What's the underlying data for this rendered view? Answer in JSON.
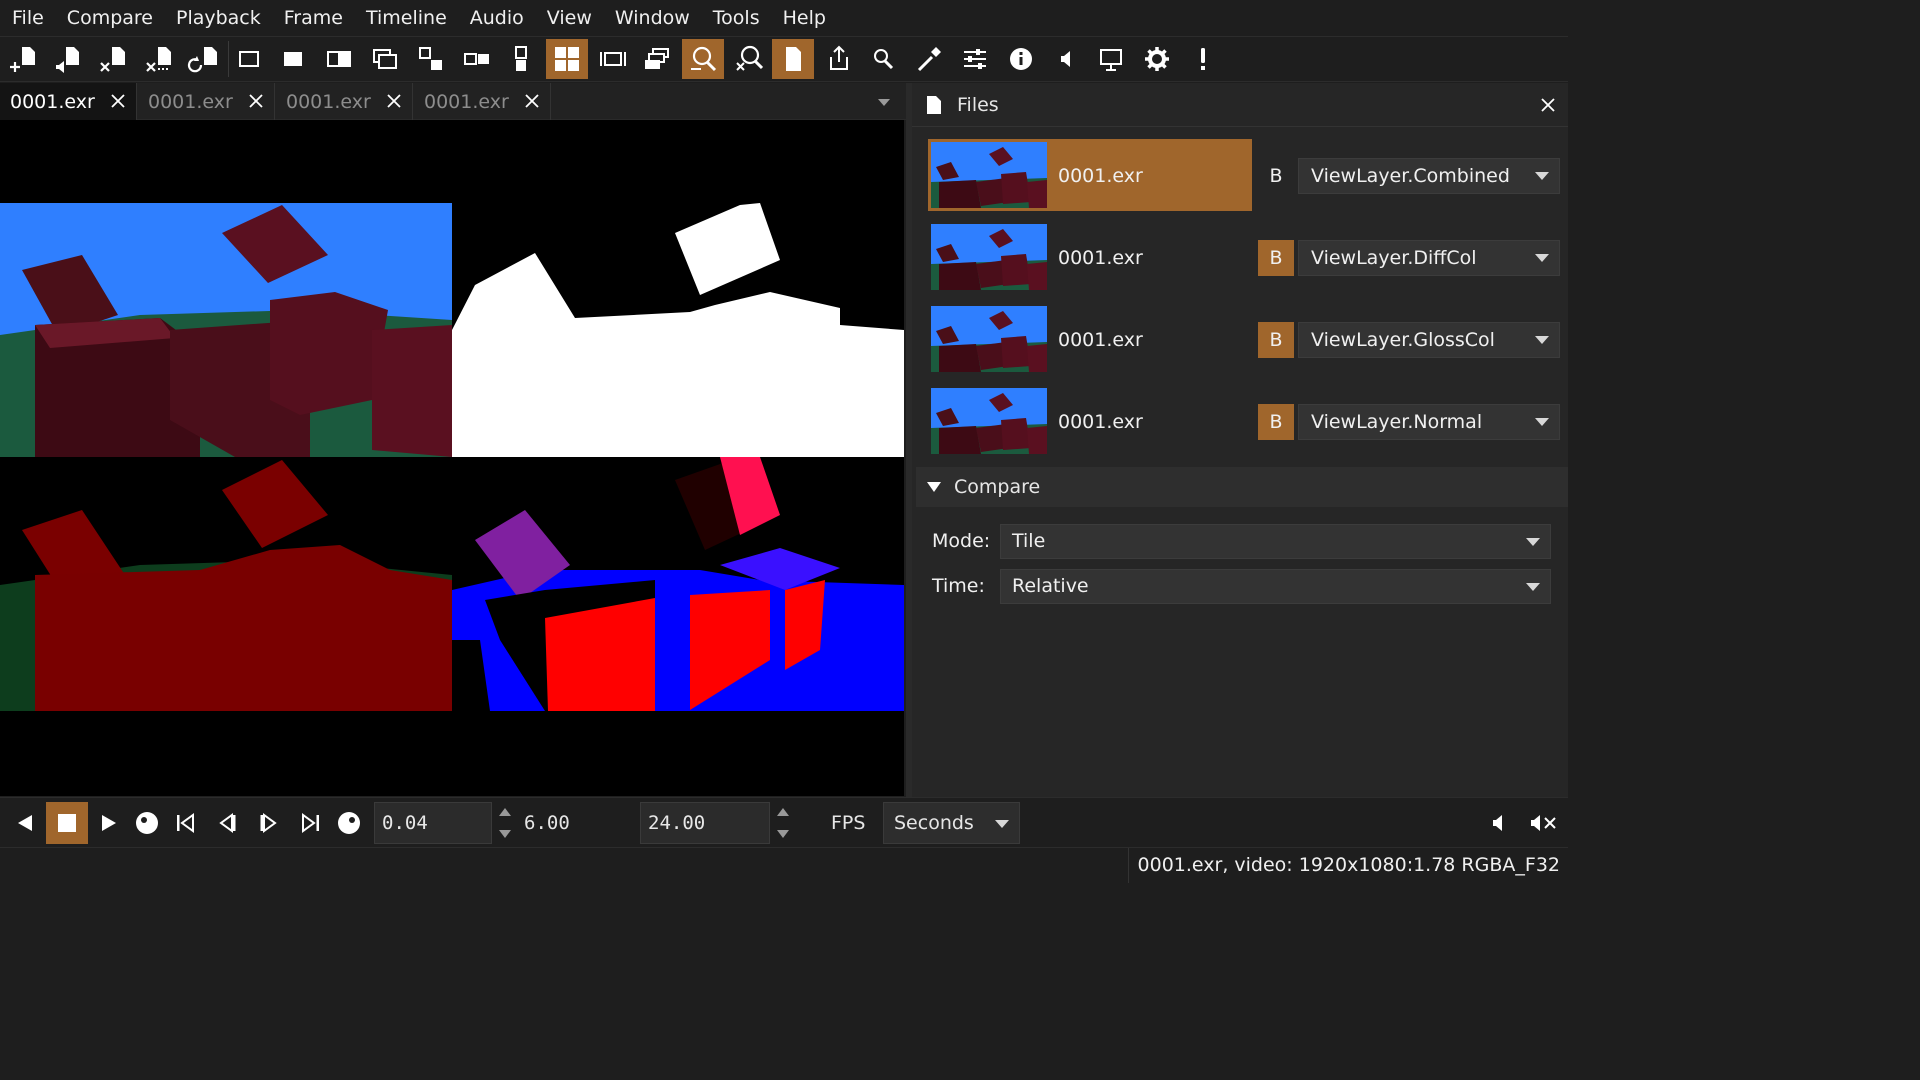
{
  "menu": [
    "File",
    "Compare",
    "Playback",
    "Frame",
    "Timeline",
    "Audio",
    "View",
    "Window",
    "Tools",
    "Help"
  ],
  "tabs": [
    {
      "label": "0001.exr"
    },
    {
      "label": "0001.exr"
    },
    {
      "label": "0001.exr"
    },
    {
      "label": "0001.exr"
    }
  ],
  "files_panel": {
    "title": "Files",
    "items": [
      {
        "name": "0001.exr",
        "b": "B",
        "layer": "ViewLayer.Combined",
        "active": true,
        "b_on": false
      },
      {
        "name": "0001.exr",
        "b": "B",
        "layer": "ViewLayer.DiffCol",
        "active": false,
        "b_on": true
      },
      {
        "name": "0001.exr",
        "b": "B",
        "layer": "ViewLayer.GlossCol",
        "active": false,
        "b_on": true
      },
      {
        "name": "0001.exr",
        "b": "B",
        "layer": "ViewLayer.Normal",
        "active": false,
        "b_on": true
      }
    ],
    "compare": {
      "title": "Compare",
      "mode_label": "Mode:",
      "mode_value": "Tile",
      "time_label": "Time:",
      "time_value": "Relative"
    }
  },
  "playback": {
    "current_time": "0.04",
    "duration": "6.00",
    "speed": "24.00",
    "fps_label": "FPS",
    "time_units": "Seconds"
  },
  "status": "0001.exr, video: 1920x1080:1.78 RGBA_F32",
  "colors": {
    "accent": "#a0662c",
    "background": "#1e1e1e",
    "panel": "#262626"
  }
}
